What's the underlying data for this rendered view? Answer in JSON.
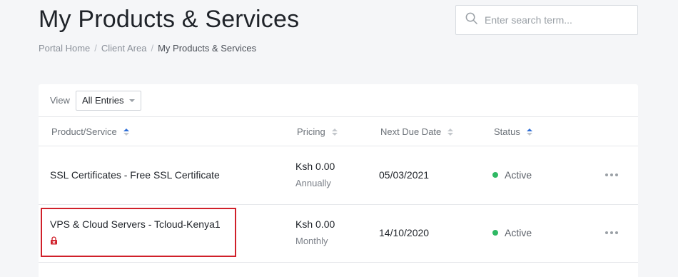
{
  "header": {
    "title": "My Products & Services",
    "breadcrumb": [
      "Portal Home",
      "Client Area",
      "My Products & Services"
    ]
  },
  "search": {
    "placeholder": "Enter search term...",
    "icon": "search-icon"
  },
  "view": {
    "label": "View",
    "selected": "All Entries"
  },
  "table": {
    "columns": [
      "Product/Service",
      "Pricing",
      "Next Due Date",
      "Status"
    ],
    "rows": [
      {
        "product": "SSL Certificates - Free SSL Certificate",
        "price": "Ksh 0.00",
        "cycle": "Annually",
        "due": "05/03/2021",
        "status": "Active"
      },
      {
        "product": "VPS & Cloud Servers - Tcloud-Kenya1",
        "price": "Ksh 0.00",
        "cycle": "Monthly",
        "due": "14/10/2020",
        "status": "Active"
      }
    ]
  },
  "colors": {
    "active_status": "#2fb964",
    "highlight": "#d0202a",
    "sort_active": "#2f6fd8"
  }
}
